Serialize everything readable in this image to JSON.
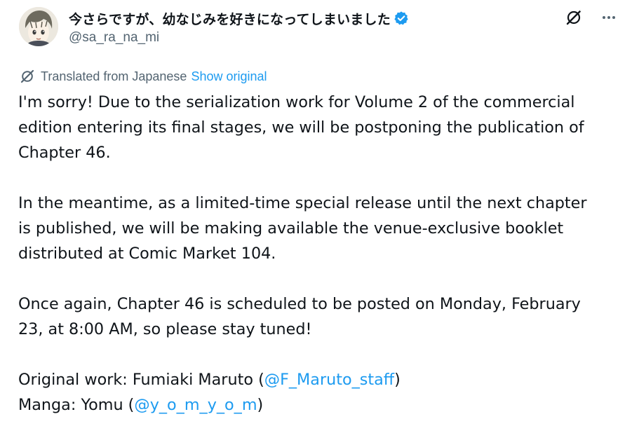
{
  "author": {
    "display_name": "今さらですが、幼なじみを好きになってしまいました",
    "handle": "@sa_ra_na_mi",
    "verified_icon": "verified-badge-icon",
    "avatar": "avatar"
  },
  "actions": {
    "grok_icon": "grok-icon",
    "more_icon": "more-options-icon"
  },
  "translation": {
    "label": "Translated from Japanese",
    "show_original": "Show original"
  },
  "tweet": {
    "p1": {
      "l1": "I'm sorry! Due to the serialization work for Volume 2 of the commercial",
      "l2": "edition entering its final stages, we will be postponing the publication of",
      "l3": "Chapter 46."
    },
    "p2": {
      "l1": "In the meantime, as a limited-time special release until the next chapter",
      "l2": "is published, we will be making available the venue-exclusive booklet",
      "l3": "distributed at Comic Market 104."
    },
    "p3": {
      "l1": "Once again, Chapter 46 is scheduled to be posted on Monday, February",
      "l2": "23, at 8:00 AM, so please stay tuned!"
    },
    "credits": {
      "original_prefix": "Original work: Fumiaki Maruto (",
      "original_mention": "@F_Maruto_staff",
      "original_suffix": ")",
      "manga_prefix": "Manga: Yomu (",
      "manga_mention": "@y_o_m_y_o_m",
      "manga_suffix": ")"
    }
  },
  "colors": {
    "text": "#0f1419",
    "secondary": "#536471",
    "link": "#1d9bf0"
  }
}
